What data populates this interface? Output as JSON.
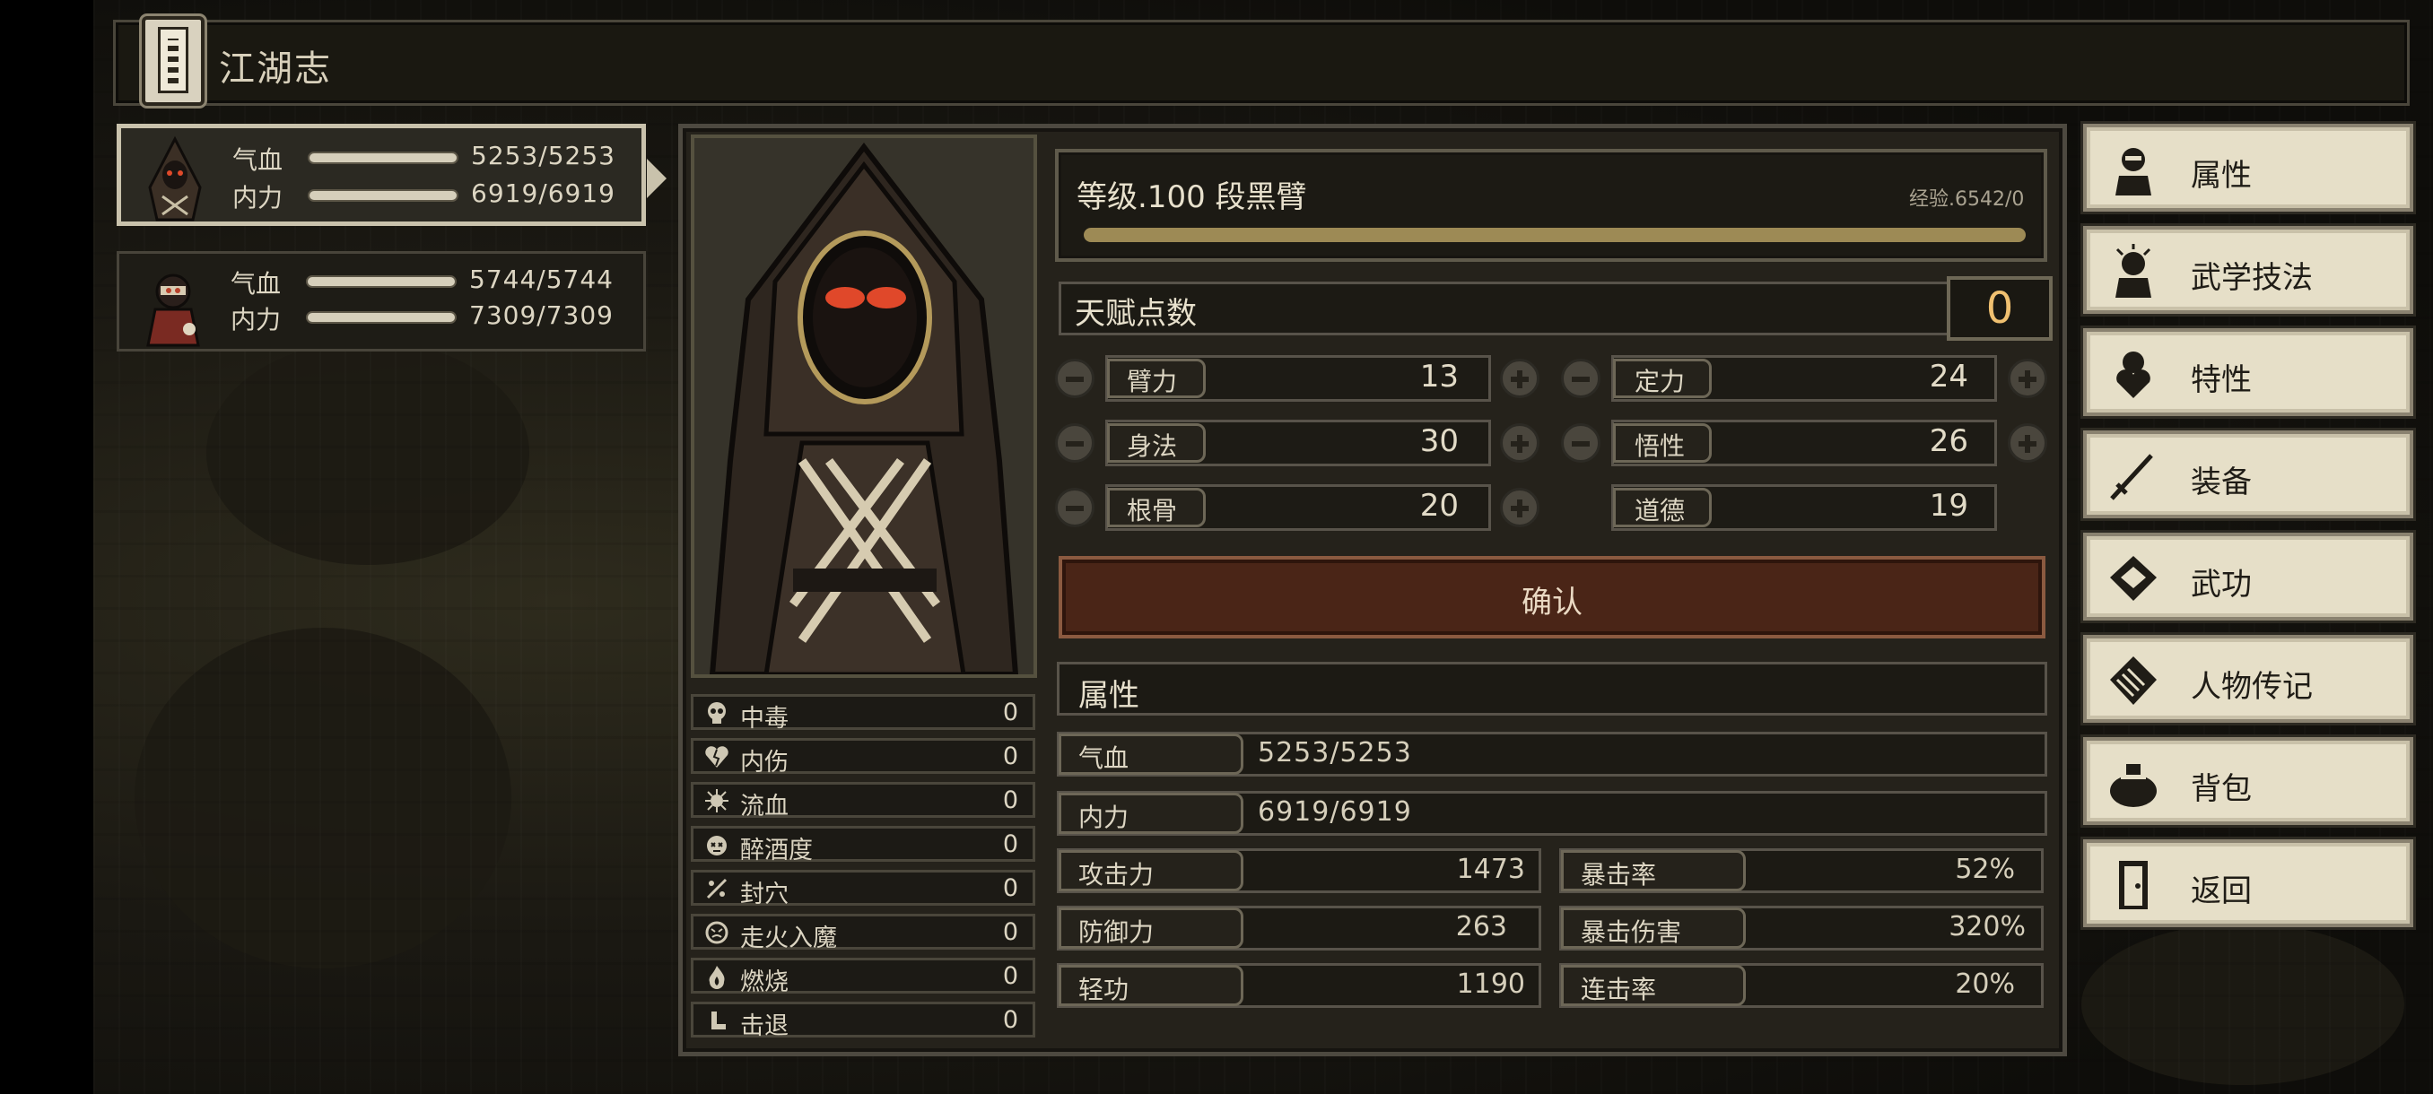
{
  "header": {
    "title": "江湖志"
  },
  "party": [
    {
      "hp_label": "气血",
      "hp_value": "5253/5253",
      "mp_label": "内力",
      "mp_value": "6919/6919",
      "active": true
    },
    {
      "hp_label": "气血",
      "hp_value": "5744/5744",
      "mp_label": "内力",
      "mp_value": "7309/7309",
      "active": false
    }
  ],
  "character": {
    "level_text": "等级.100 段黑臂",
    "exp_text": "经验.6542/0",
    "talent_label": "天赋点数",
    "talent_points": "0",
    "attributes": [
      {
        "name": "臂力",
        "value": "13"
      },
      {
        "name": "定力",
        "value": "24"
      },
      {
        "name": "身法",
        "value": "30"
      },
      {
        "name": "悟性",
        "value": "26"
      },
      {
        "name": "根骨",
        "value": "20"
      },
      {
        "name": "道德",
        "value": "19"
      }
    ],
    "confirm_label": "确认",
    "section_label": "属性",
    "hp": {
      "label": "气血",
      "value": "5253/5253"
    },
    "mp": {
      "label": "内力",
      "value": "6919/6919"
    },
    "stats": [
      {
        "label": "攻击力",
        "value": "1473"
      },
      {
        "label": "暴击率",
        "value": "52%"
      },
      {
        "label": "防御力",
        "value": "263"
      },
      {
        "label": "暴击伤害",
        "value": "320%"
      },
      {
        "label": "轻功",
        "value": "1190"
      },
      {
        "label": "连击率",
        "value": "20%"
      }
    ]
  },
  "status_effects": [
    {
      "name": "中毒",
      "value": "0",
      "icon": "skull-icon"
    },
    {
      "name": "内伤",
      "value": "0",
      "icon": "broken-heart-icon"
    },
    {
      "name": "流血",
      "value": "0",
      "icon": "blood-splash-icon"
    },
    {
      "name": "醉酒度",
      "value": "0",
      "icon": "dizzy-face-icon"
    },
    {
      "name": "封穴",
      "value": "0",
      "icon": "needle-icon"
    },
    {
      "name": "走火入魔",
      "value": "0",
      "icon": "demon-icon"
    },
    {
      "name": "燃烧",
      "value": "0",
      "icon": "flame-icon"
    },
    {
      "name": "击退",
      "value": "0",
      "icon": "boot-icon"
    }
  ],
  "menu": [
    {
      "label": "属性",
      "icon": "character-icon"
    },
    {
      "label": "武学技法",
      "icon": "character-skills-icon"
    },
    {
      "label": "特性",
      "icon": "character-heart-icon"
    },
    {
      "label": "装备",
      "icon": "sword-icon"
    },
    {
      "label": "武功",
      "icon": "manual-book-icon"
    },
    {
      "label": "人物传记",
      "icon": "scroll-icon"
    },
    {
      "label": "背包",
      "icon": "bag-icon"
    },
    {
      "label": "返回",
      "icon": "door-icon"
    }
  ],
  "colors": {
    "accent_gold": "#f0c070",
    "exp_bar": "#9d8a55",
    "confirm_bg": "#4a2517",
    "menu_bg": "#e6dfc8"
  }
}
